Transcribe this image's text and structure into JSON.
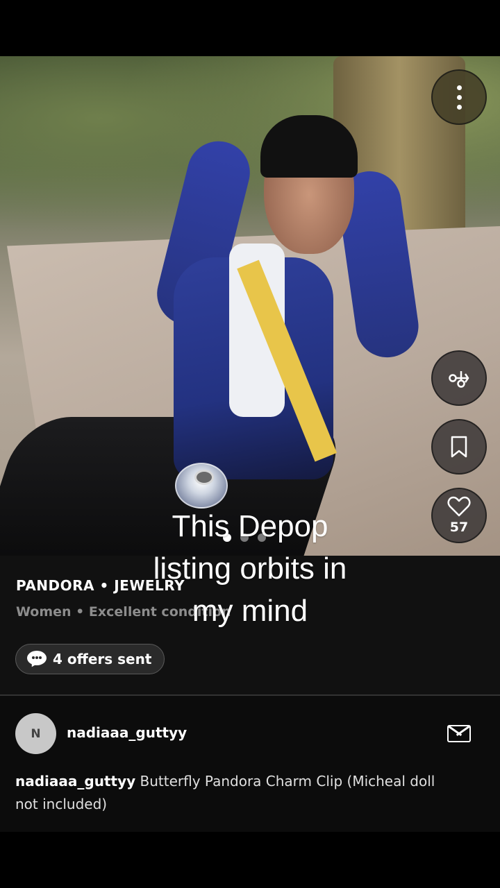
{
  "listing": {
    "brand_category": "PANDORA • JEWELRY",
    "meta": "Women • Excellent condition",
    "offers": "4 offers sent",
    "likes": "57"
  },
  "seller": {
    "avatar_initial": "N",
    "username": "nadiaaa_guttyy"
  },
  "description": {
    "username": "nadiaaa_guttyy",
    "text": " Butterfly Pandora Charm Clip (Micheal doll not included)"
  },
  "overlay": {
    "caption": "This Depop listing orbits in my mind"
  },
  "icons": {
    "more": "more-vertical-icon",
    "share": "share-icon",
    "save": "bookmark-icon",
    "like": "heart-icon",
    "message": "mail-icon",
    "offers": "speech-bubble-icon"
  },
  "carousel": {
    "total": 3,
    "active": 1
  }
}
